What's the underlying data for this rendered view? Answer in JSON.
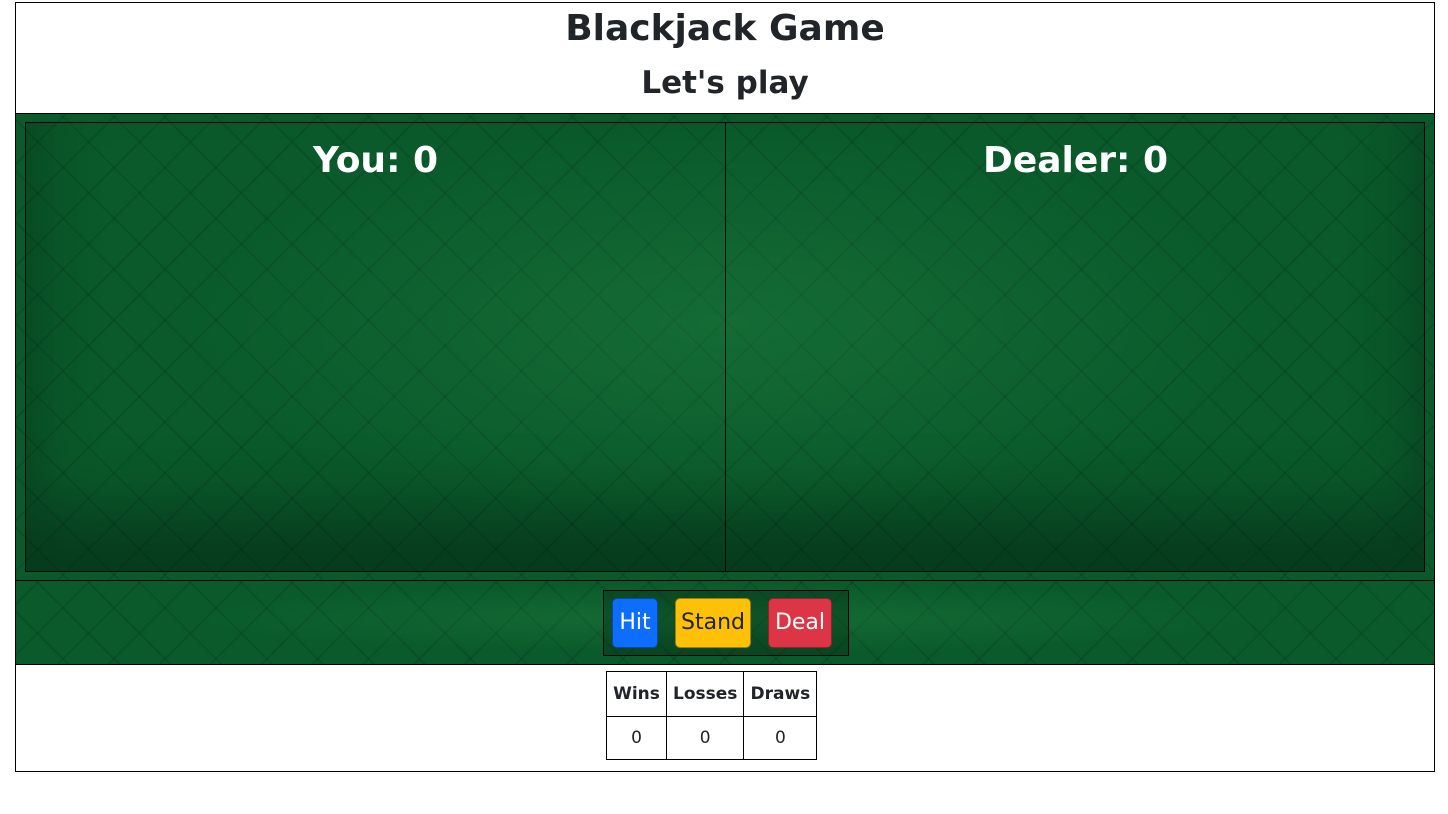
{
  "header": {
    "title": "Blackjack Game",
    "subtitle": "Let's play"
  },
  "player": {
    "label": "You:",
    "score": "0",
    "score_text": "You: 0"
  },
  "dealer": {
    "label": "Dealer:",
    "score": "0",
    "score_text": "Dealer: 0"
  },
  "controls": {
    "hit_label": "Hit",
    "stand_label": "Stand",
    "deal_label": "Deal"
  },
  "stats": {
    "headers": [
      "Wins",
      "Losses",
      "Draws"
    ],
    "values": [
      "0",
      "0",
      "0"
    ]
  },
  "colors": {
    "felt": "#0a5a2b",
    "hit": "#0d6efd",
    "stand": "#ffc107",
    "deal": "#dc3545"
  }
}
